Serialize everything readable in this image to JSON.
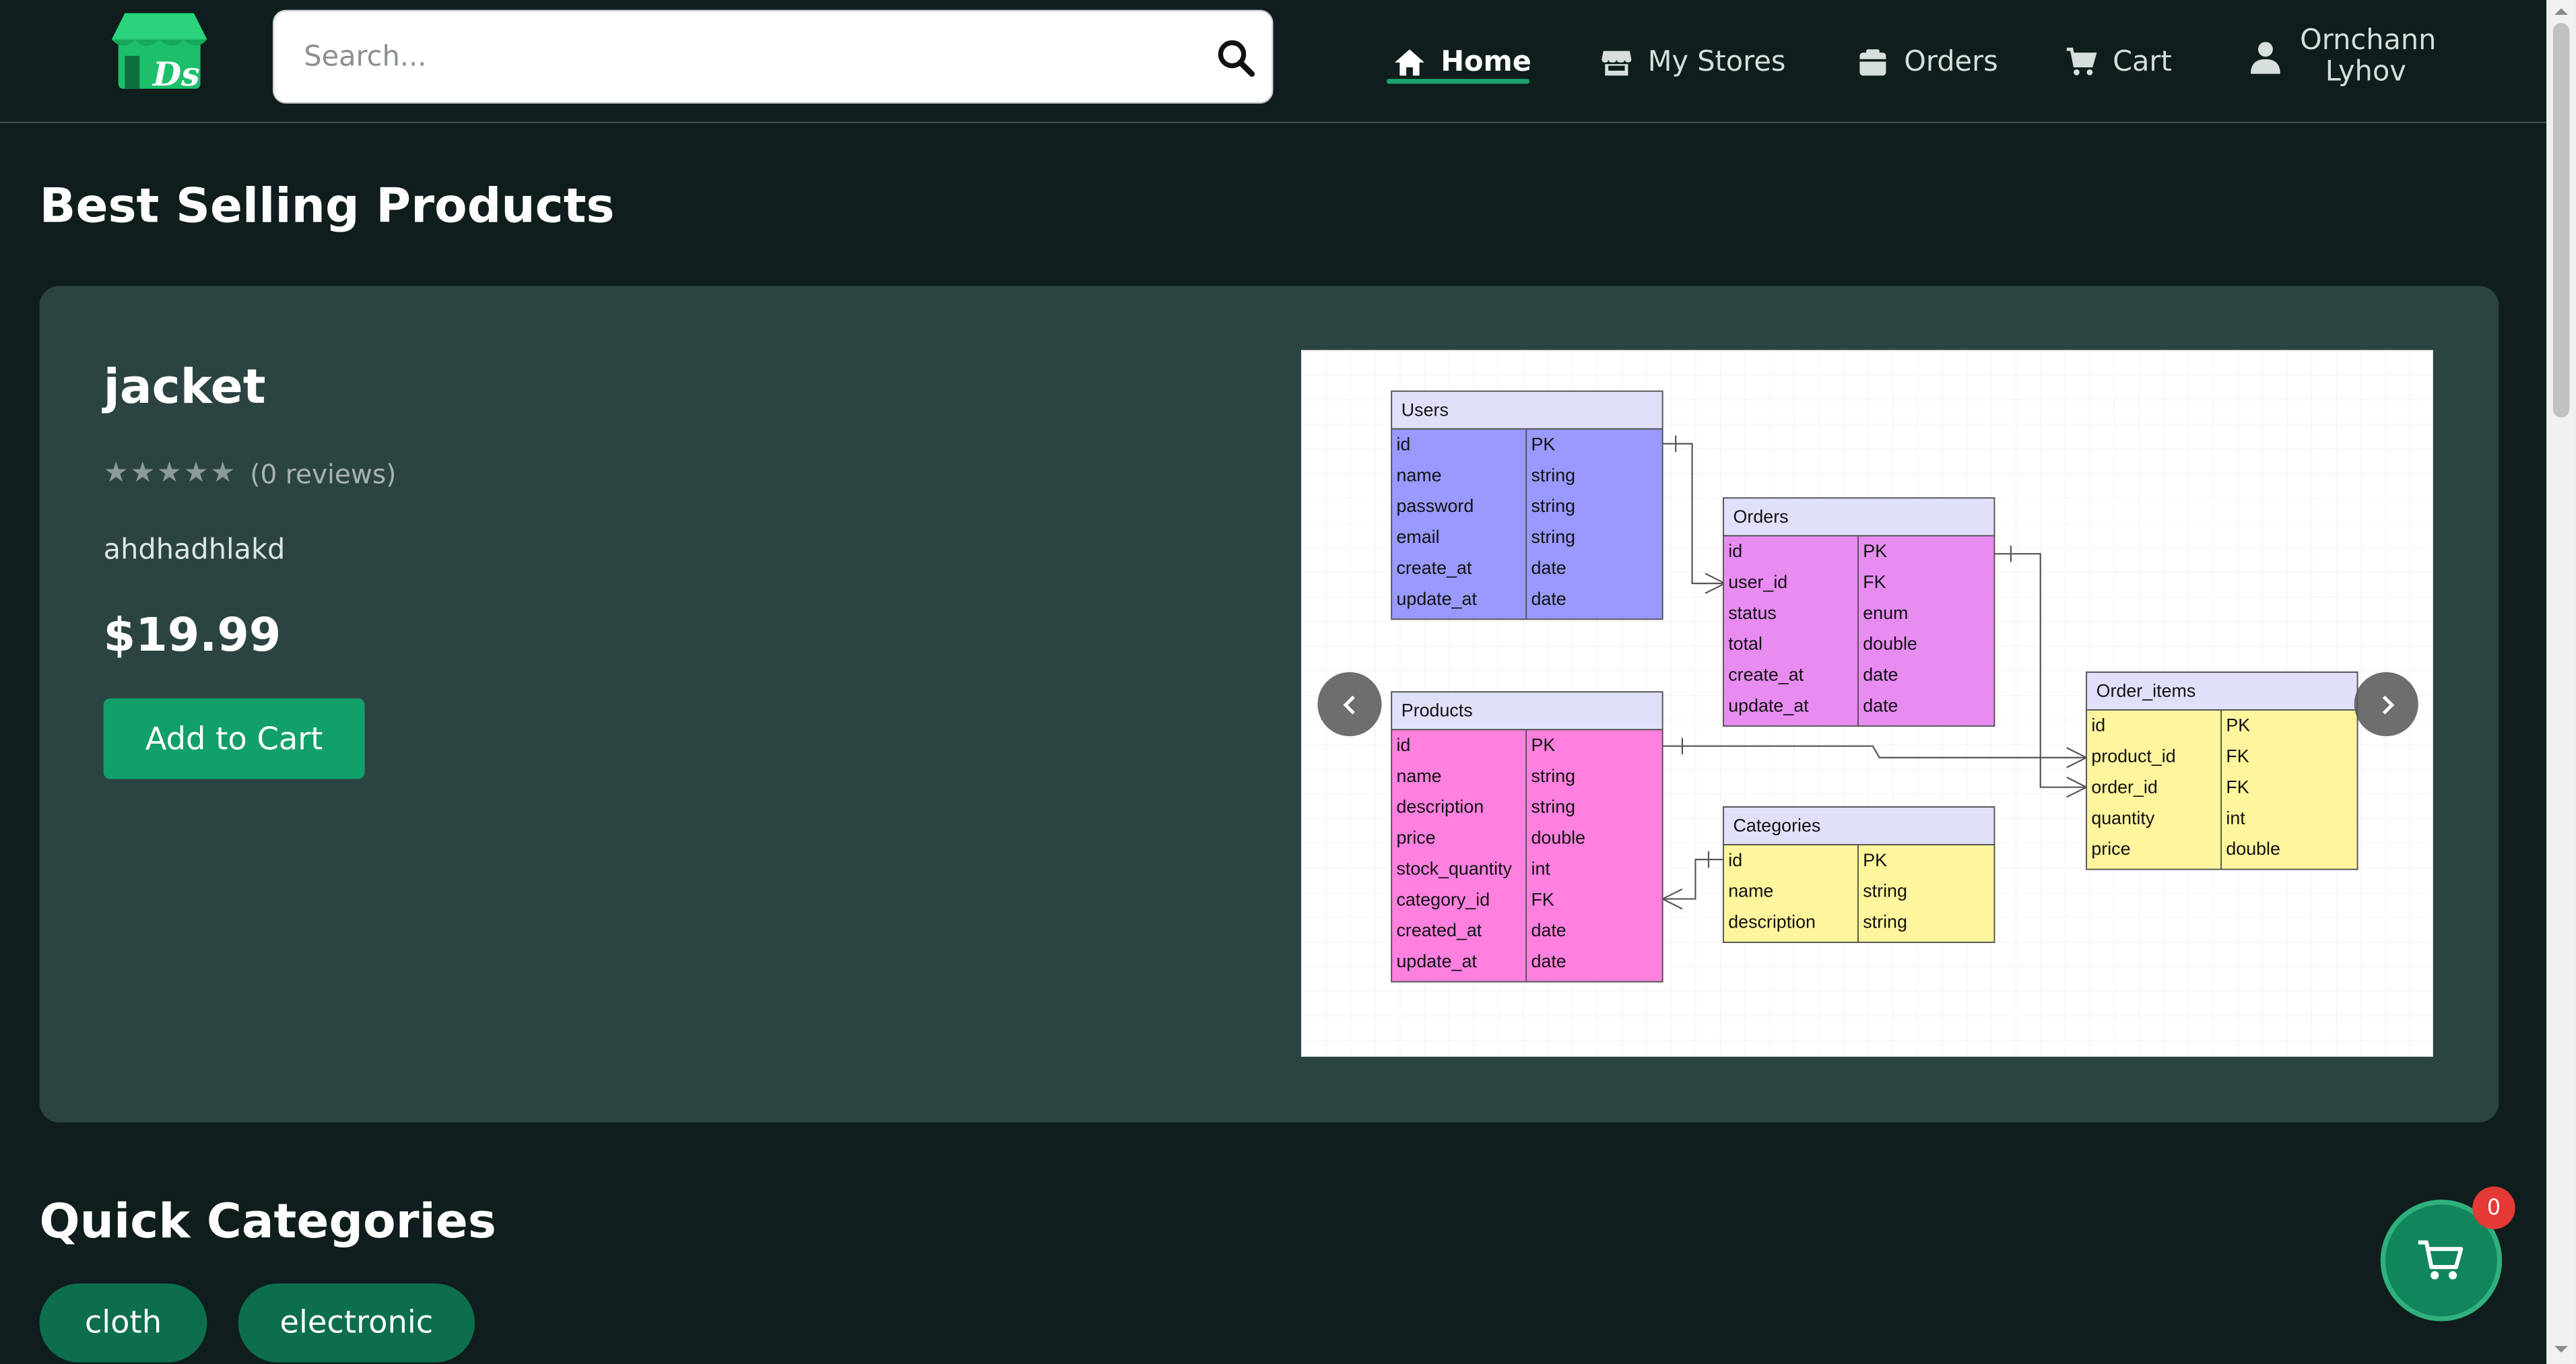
{
  "nav": {
    "search_placeholder": "Search...",
    "items": [
      {
        "label": "Home",
        "icon": "home-icon",
        "active": true
      },
      {
        "label": "My Stores",
        "icon": "store-icon",
        "active": false
      },
      {
        "label": "Orders",
        "icon": "orders-icon",
        "active": false
      },
      {
        "label": "Cart",
        "icon": "cart-icon",
        "active": false
      }
    ],
    "user_name": "Ornchann Lyhov",
    "logo_text": "Ds",
    "accent": "#1aa36b"
  },
  "best_selling": {
    "title": "Best Selling Products",
    "product": {
      "name": "jacket",
      "stars": "★★★★★",
      "reviews": "(0 reviews)",
      "rating": 0,
      "description": "ahdhadhlakd",
      "price": "$19.99",
      "add_to_cart_label": "Add to Cart"
    }
  },
  "erd": {
    "tables": [
      {
        "name": "Users",
        "rows": [
          [
            "id",
            "PK"
          ],
          [
            "name",
            "string"
          ],
          [
            "password",
            "string"
          ],
          [
            "email",
            "string"
          ],
          [
            "create_at",
            "date"
          ],
          [
            "update_at",
            "date"
          ]
        ],
        "color": "#9999ff"
      },
      {
        "name": "Orders",
        "rows": [
          [
            "id",
            "PK"
          ],
          [
            "user_id",
            "FK"
          ],
          [
            "status",
            "enum"
          ],
          [
            "total",
            "double"
          ],
          [
            "create_at",
            "date"
          ],
          [
            "update_at",
            "date"
          ]
        ],
        "color": "#e88cf2"
      },
      {
        "name": "Products",
        "rows": [
          [
            "id",
            "PK"
          ],
          [
            "name",
            "string"
          ],
          [
            "description",
            "string"
          ],
          [
            "price",
            "double"
          ],
          [
            "stock_quantity",
            "int"
          ],
          [
            "category_id",
            "FK"
          ],
          [
            "created_at",
            "date"
          ],
          [
            "update_at",
            "date"
          ]
        ],
        "color": "#ff80df"
      },
      {
        "name": "Categories",
        "rows": [
          [
            "id",
            "PK"
          ],
          [
            "name",
            "string"
          ],
          [
            "description",
            "string"
          ]
        ],
        "color": "#fff59d"
      },
      {
        "name": "Order_items",
        "rows": [
          [
            "id",
            "PK"
          ],
          [
            "product_id",
            "FK"
          ],
          [
            "order_id",
            "FK"
          ],
          [
            "quantity",
            "int"
          ],
          [
            "price",
            "double"
          ]
        ],
        "color": "#fff59d"
      }
    ]
  },
  "categories": {
    "title": "Quick Categories",
    "items": [
      "cloth",
      "electronic"
    ]
  },
  "cart_fab": {
    "count": "0"
  }
}
